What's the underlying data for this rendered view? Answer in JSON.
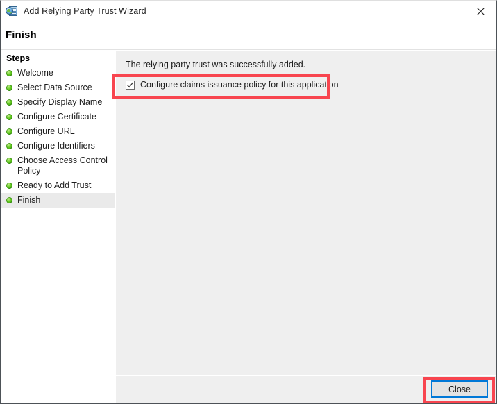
{
  "window": {
    "title": "Add Relying Party Trust Wizard",
    "icon": "adfs-relying-party-icon",
    "close_glyph": "✕"
  },
  "header": {
    "title": "Finish"
  },
  "sidebar": {
    "heading": "Steps",
    "items": [
      {
        "label": "Welcome",
        "state": "done"
      },
      {
        "label": "Select Data Source",
        "state": "done"
      },
      {
        "label": "Specify Display Name",
        "state": "done"
      },
      {
        "label": "Configure Certificate",
        "state": "done"
      },
      {
        "label": "Configure URL",
        "state": "done"
      },
      {
        "label": "Configure Identifiers",
        "state": "done"
      },
      {
        "label": "Choose Access Control\nPolicy",
        "state": "done"
      },
      {
        "label": "Ready to Add Trust",
        "state": "done"
      },
      {
        "label": "Finish",
        "state": "current"
      }
    ]
  },
  "main": {
    "success_message": "The relying party trust was successfully added.",
    "checkbox": {
      "label": "Configure claims issuance policy for this application",
      "checked": true
    }
  },
  "footer": {
    "close_label": "Close"
  },
  "annotations": {
    "color": "#f8454f",
    "targets": [
      "configure-claims-checkbox",
      "close-button"
    ]
  }
}
